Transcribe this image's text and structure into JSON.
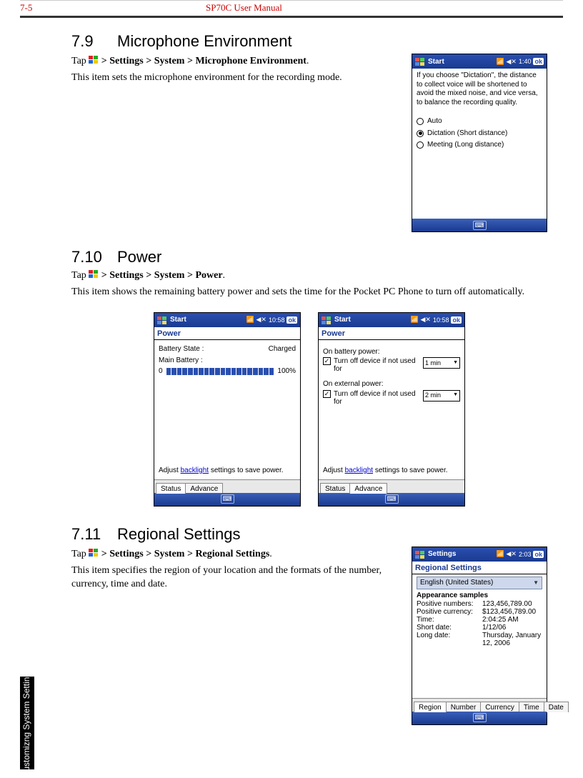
{
  "header": {
    "page_no": "7-5",
    "manual_title": "SP70C User Manual"
  },
  "side_tab": "Customizng\nSystem Settings",
  "s79": {
    "num": "7.9",
    "title": "Microphone Environment",
    "tap_prefix": "Tap ",
    "tap_path": " > Settings > System > Microphone Environment",
    "period": ".",
    "desc": "This item sets the microphone environment for the recording mode.",
    "shot": {
      "title": "Start",
      "time": "1:40",
      "ok": "ok",
      "hint": "If you choose \"Dictation\", the distance to collect voice will be shortened to avoid the mixed noise, and vice versa, to balance the recording quality.",
      "opts": [
        {
          "label": "Auto",
          "sel": false
        },
        {
          "label": "Dictation   (Short distance)",
          "sel": true
        },
        {
          "label": "Meeting   (Long distance)",
          "sel": false
        }
      ]
    }
  },
  "s710": {
    "num": "7.10",
    "title": "Power",
    "tap_prefix": "Tap ",
    "tap_path": " > Settings > System > Power",
    "period": ".",
    "desc": "This item shows the remaining battery power and sets the time for the Pocket PC Phone to turn off automatically.",
    "shot_status": {
      "title": "Start",
      "time": "10:58",
      "ok": "ok",
      "subtitle": "Power",
      "battery_state_k": "Battery State :",
      "battery_state_v": "Charged",
      "main_batt_k": "Main Battery :",
      "pct_lo": "0",
      "pct_hi": "100%",
      "tabs": [
        "Status",
        "Advance"
      ],
      "active_tab": 0,
      "hint_before": "Adjust ",
      "hint_link": "backlight",
      "hint_after": " settings to save power."
    },
    "shot_adv": {
      "title": "Start",
      "time": "10:58",
      "ok": "ok",
      "subtitle": "Power",
      "groups": [
        {
          "h": "On battery power:",
          "chk": true,
          "t": "Turn off device if not used for",
          "val": "1 min"
        },
        {
          "h": "On external power:",
          "chk": true,
          "t": "Turn off device if not used for",
          "val": "2 min"
        }
      ],
      "tabs": [
        "Status",
        "Advance"
      ],
      "active_tab": 1,
      "hint_before": "Adjust ",
      "hint_link": "backlight",
      "hint_after": " settings to save power."
    }
  },
  "s711": {
    "num": "7.11",
    "title": "Regional Settings",
    "tap_prefix": "Tap ",
    "tap_path": " > Settings > System > Regional Settings",
    "period": ".",
    "desc": "This item specifies the region of your location and the formats of the number, currency, time and date.",
    "shot": {
      "title": "Settings",
      "time": "2:03",
      "ok": "ok",
      "subtitle": "Regional Settings",
      "locale": "English (United States)",
      "samples_head": "Appearance samples",
      "rows": [
        {
          "k": "Positive numbers:",
          "v": "123,456,789.00"
        },
        {
          "k": "Positive currency:",
          "v": "$123,456,789.00"
        },
        {
          "k": "Time:",
          "v": "2:04:25 AM"
        },
        {
          "k": "Short date:",
          "v": "1/12/06"
        },
        {
          "k": "Long date:",
          "v": "Thursday, January 12, 2006"
        }
      ],
      "tabs": [
        "Region",
        "Number",
        "Currency",
        "Time",
        "Date"
      ],
      "active_tab": 0
    }
  }
}
